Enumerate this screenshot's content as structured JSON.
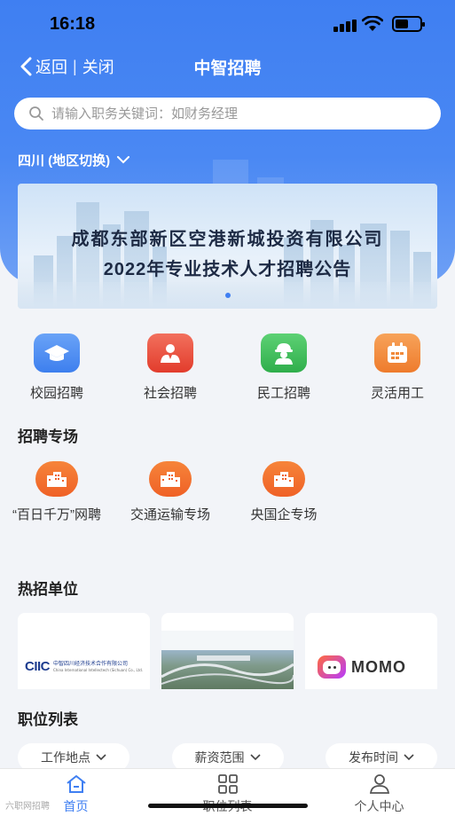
{
  "status_bar": {
    "time": "16:18"
  },
  "nav": {
    "back_label": "返回",
    "separator": "|",
    "close_label": "关闭",
    "title": "中智招聘"
  },
  "search": {
    "placeholder": "请输入职务关键词：如财务经理"
  },
  "region": {
    "label": "四川 (地区切换)"
  },
  "banner": {
    "line1": "成都东部新区空港新城投资有限公司",
    "line2": "2022年专业技术人才招聘公告",
    "active_slide": 1
  },
  "quick_entries": [
    {
      "label": "校园招聘",
      "icon": "graduation-cap-icon",
      "color": "#4d8ef0"
    },
    {
      "label": "社会招聘",
      "icon": "people-icon",
      "color": "#ea4b3a"
    },
    {
      "label": "民工招聘",
      "icon": "worker-icon",
      "color": "#3fbf5a"
    },
    {
      "label": "灵活用工",
      "icon": "calendar-icon",
      "color": "#f08a3c"
    }
  ],
  "special": {
    "title": "招聘专场",
    "items": [
      {
        "label": "“百日千万”网聘",
        "icon": "building-icon"
      },
      {
        "label": "交通运输专场",
        "icon": "building-icon"
      },
      {
        "label": "央国企专场",
        "icon": "building-icon"
      }
    ]
  },
  "hot_companies": {
    "title": "热招单位",
    "items": [
      {
        "logo_text": "CIIC",
        "name": "中智四川经济技术合作有限公司",
        "name_en": "China International Intellectech (Sichuan) Co., Ltd."
      },
      {
        "logo_text": "",
        "name": "",
        "name_en": ""
      },
      {
        "logo_text": "MOMO",
        "name": "",
        "name_en": ""
      }
    ]
  },
  "jobs": {
    "title": "职位列表",
    "filters": [
      "工作地点",
      "薪资范围",
      "发布时间"
    ]
  },
  "tabbar": [
    {
      "label": "首页",
      "icon": "home-icon",
      "active": true
    },
    {
      "label": "职位列表",
      "icon": "grid-icon",
      "active": false
    },
    {
      "label": "个人中心",
      "icon": "user-icon",
      "active": false
    }
  ],
  "watermark": "六职网招聘",
  "colors": {
    "primary": "#3f7ff2",
    "orange": "#f06a2c",
    "bg": "#f2f4f8"
  }
}
